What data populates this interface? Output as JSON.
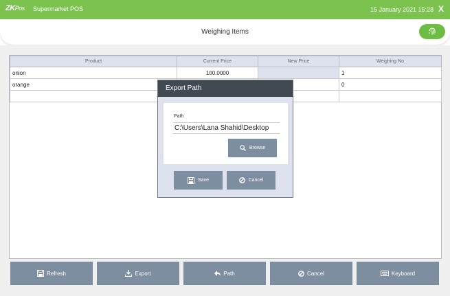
{
  "topbar": {
    "logo_main": "ZK",
    "logo_sub": "Pos",
    "app_title": "Supermarket POS",
    "datetime": "15 January 2021 15:28",
    "close_label": "X"
  },
  "header": {
    "title": "Weighing Items"
  },
  "table": {
    "columns": [
      "Product",
      "Current Price",
      "New Price",
      "Weighing No"
    ],
    "rows": [
      {
        "product": "onion",
        "current_price": "100.0000",
        "new_price": "",
        "weighing_no": "1"
      },
      {
        "product": "orange",
        "current_price": "",
        "new_price": "",
        "weighing_no": "0"
      },
      {
        "product": "",
        "current_price": "",
        "new_price": "",
        "weighing_no": ""
      }
    ]
  },
  "dialog": {
    "title": "Export Path",
    "path_label": "Path",
    "path_value": "C:\\Users\\Lana Shahid\\Desktop",
    "browse_label": "Browse",
    "save_label": "Save",
    "cancel_label": "Cancel"
  },
  "toolbar": {
    "refresh_label": "Refresh",
    "export_label": "Export",
    "path_label": "Path",
    "cancel_label": "Cancel",
    "keyboard_label": "Keyboard"
  },
  "colors": {
    "brand_green": "#7cc24e",
    "button_gray": "#7d8ea1",
    "header_blue": "#dde2ee",
    "dialog_header": "#414a51"
  }
}
